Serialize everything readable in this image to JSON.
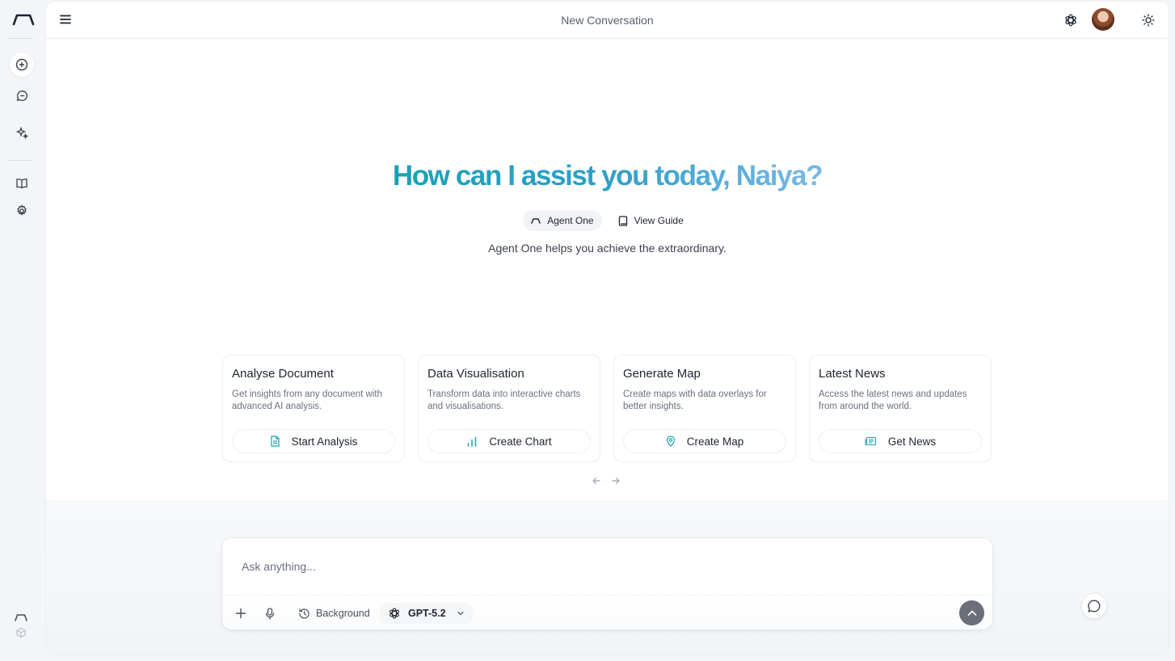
{
  "header": {
    "title": "New Conversation"
  },
  "hero": {
    "greeting": "How can I assist you today, Naiya?",
    "pills": [
      {
        "label": "Agent One",
        "icon": "agent-logo-icon",
        "active": true
      },
      {
        "label": "View Guide",
        "icon": "book-icon",
        "active": false
      }
    ],
    "tagline": "Agent One helps you achieve the extraordinary."
  },
  "cards": [
    {
      "title": "Analyse Document",
      "description": "Get insights from any document with advanced AI analysis.",
      "button": "Start Analysis",
      "icon": "document-icon"
    },
    {
      "title": "Data Visualisation",
      "description": "Transform data into interactive charts and visualisations.",
      "button": "Create Chart",
      "icon": "bar-chart-icon"
    },
    {
      "title": "Generate Map",
      "description": "Create maps with data overlays for better insights.",
      "button": "Create Map",
      "icon": "map-pin-icon"
    },
    {
      "title": "Latest News",
      "description": "Access the latest news and updates from around the world.",
      "button": "Get News",
      "icon": "newspaper-icon"
    }
  ],
  "composer": {
    "placeholder": "Ask anything...",
    "background_label": "Background",
    "model": "GPT-5.2"
  },
  "colors": {
    "accent": "#1aa1b8",
    "accent_light": "#7cb8e6",
    "send_button": "#6b6f78"
  }
}
